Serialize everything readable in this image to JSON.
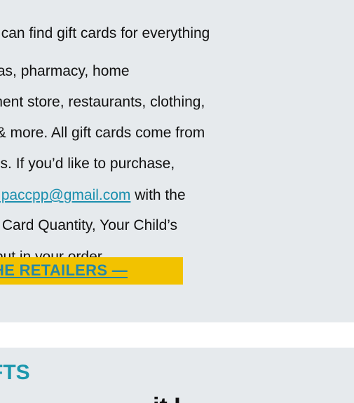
{
  "gift_cards": {
    "lines": [
      "you can find gift cards for everything",
      "s, gas, pharmacy, home",
      "artment store, restaurants, clothing,",
      "vel & more. All gift cards come from",
      "elves. If you’d like to purchase,"
    ],
    "email_link": "info.paccpp@gmail.com",
    "after_email": " with the",
    "line_7": "unt, Card Quantity, Your Child’s",
    "line_8": "e'll put in your order.",
    "cta_label": "HE RETAILERS —"
  },
  "next_section": {
    "title": "FTS",
    "cut_text": "it I"
  },
  "colors": {
    "panel_bg": "#e6eaed",
    "link": "#1b8fae",
    "cta_bg": "#f2c200",
    "title": "#1b97ad"
  }
}
